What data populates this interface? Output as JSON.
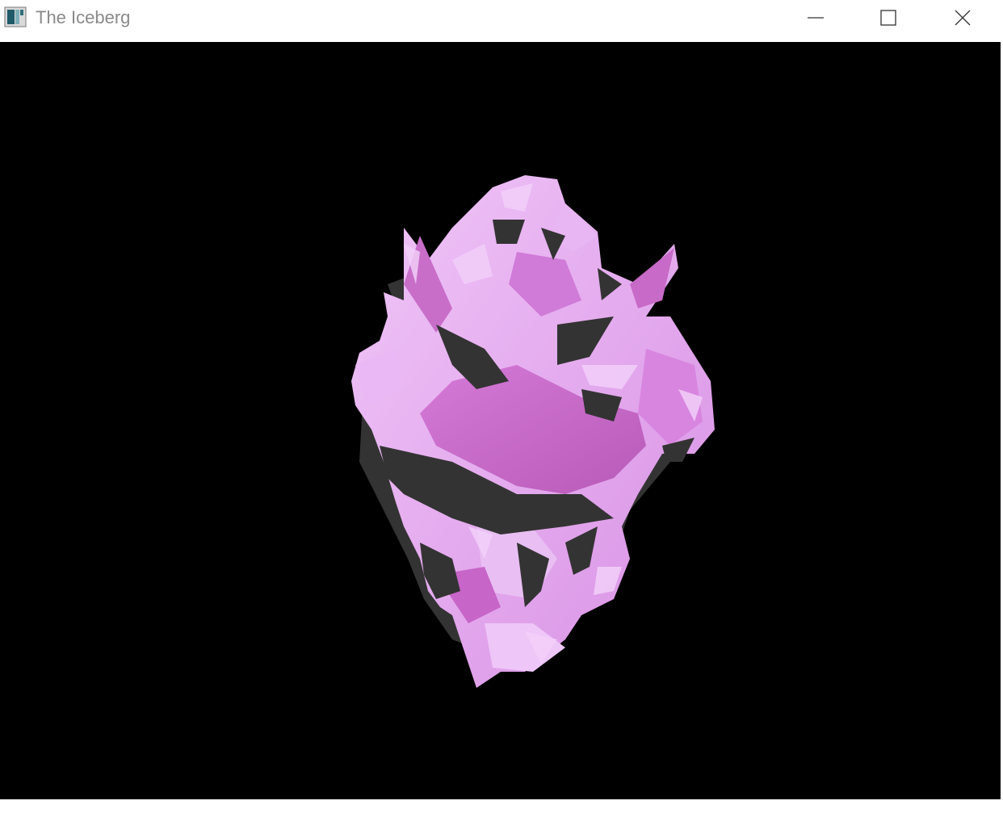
{
  "window": {
    "title": "The Iceberg",
    "controls": {
      "minimize": "minimize-icon",
      "maximize": "maximize-icon",
      "close": "close-icon"
    }
  },
  "viewport": {
    "background": "#000000",
    "model_colors": {
      "light": "#e6b0f0",
      "mid": "#d48ae0",
      "deep": "#c768c8",
      "shadow": "#333333"
    }
  }
}
